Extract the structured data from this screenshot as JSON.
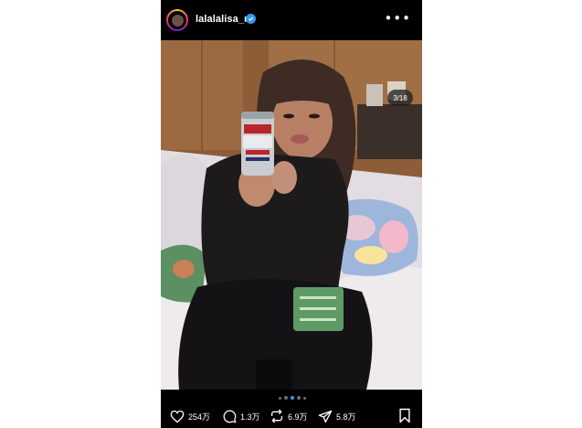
{
  "header": {
    "username": "lalalalisa_m",
    "verified": true
  },
  "carousel": {
    "position": "3/18",
    "dots_total": 5,
    "dots_active_index": 2
  },
  "actions": {
    "likes": "254万",
    "comments": "1.3万",
    "reposts": "6.9万",
    "shares": "5.8万"
  },
  "colors": {
    "background": "#000000",
    "verified_badge": "#3897f0",
    "active_dot": "#3897f0"
  },
  "icons": [
    "more-options-icon",
    "verified-badge-icon",
    "heart-icon",
    "comment-icon",
    "repost-icon",
    "share-icon",
    "bookmark-icon"
  ]
}
